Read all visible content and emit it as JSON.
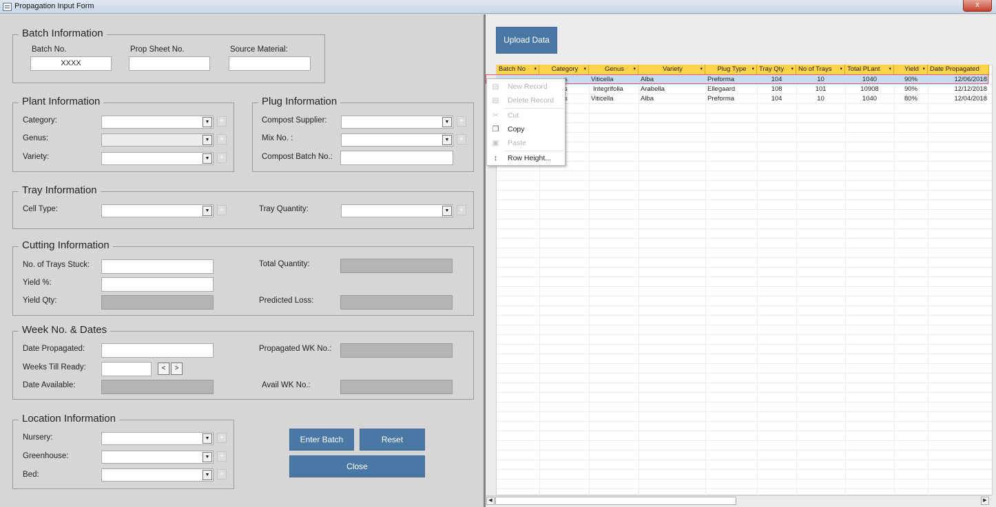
{
  "window": {
    "title": "Propagation Input Form",
    "close_label": "x"
  },
  "batch": {
    "title": "Batch Information",
    "batch_no_label": "Batch No.",
    "batch_no_value": "XXXX",
    "prop_sheet_label": "Prop Sheet No.",
    "source_label": "Source Material:"
  },
  "plant": {
    "title": "Plant Information",
    "category_label": "Category:",
    "genus_label": "Genus:",
    "variety_label": "Variety:"
  },
  "plug": {
    "title": "Plug Information",
    "compost_supplier_label": "Compost Supplier:",
    "mix_label": "Mix No. :",
    "compost_batch_label": "Compost Batch No.:"
  },
  "tray": {
    "title": "Tray Information",
    "cell_type_label": "Cell Type:",
    "tray_qty_label": "Tray Quantity:"
  },
  "cutting": {
    "title": "Cutting Information",
    "trays_stuck_label": "No. of Trays Stuck:",
    "yield_pct_label": "Yield %:",
    "yield_qty_label": "Yield Qty:",
    "total_qty_label": "Total Quantity:",
    "predicted_loss_label": "Predicted Loss:"
  },
  "week": {
    "title": "Week No. & Dates",
    "date_prop_label": "Date Propagated:",
    "weeks_ready_label": "Weeks Till Ready:",
    "date_avail_label": "Date Available:",
    "prop_wk_label": "Propagated WK No.:",
    "avail_wk_label": "Avail WK No.:",
    "prev_label": "<",
    "next_label": ">"
  },
  "location": {
    "title": "Location Information",
    "nursery_label": "Nursery:",
    "greenhouse_label": "Greenhouse:",
    "bed_label": "Bed:"
  },
  "buttons": {
    "enter_batch": "Enter Batch",
    "reset": "Reset",
    "close": "Close",
    "upload": "Upload Data"
  },
  "icons": {
    "dropdown": "▼",
    "plus": "+",
    "sort": "▾"
  },
  "table": {
    "columns": [
      "Batch No",
      "Category",
      "Genus",
      "Variety",
      "Plug Type",
      "Tray Qty",
      "No of Trays",
      "Total PLant",
      "Yield",
      "Date Propagated"
    ],
    "rows": [
      [
        "",
        "s",
        "Viticella",
        "Alba",
        "Preforma",
        "104",
        "10",
        "1040",
        "90%",
        "12/06/2018"
      ],
      [
        "",
        "s",
        "Integrifolia",
        "Arabella",
        "Ellegaard",
        "108",
        "101",
        "10908",
        "90%",
        "12/12/2018"
      ],
      [
        "",
        "s",
        "Viticella",
        "Alba",
        "Preforma",
        "104",
        "10",
        "1040",
        "80%",
        "12/04/2018"
      ]
    ]
  },
  "context_menu": {
    "items": [
      {
        "label": "New Record",
        "icon": "new-record-icon",
        "enabled": false
      },
      {
        "label": "Delete Record",
        "icon": "delete-record-icon",
        "enabled": false
      },
      {
        "label": "Cut",
        "icon": "scissors-icon",
        "enabled": false
      },
      {
        "label": "Copy",
        "icon": "copy-icon",
        "enabled": true
      },
      {
        "label": "Paste",
        "icon": "paste-icon",
        "enabled": false
      },
      {
        "label": "Row Height...",
        "icon": "row-height-icon",
        "enabled": true
      }
    ]
  },
  "colors": {
    "button": "#4a78a4",
    "header": "#ffd24a",
    "selected_row": "#c7dcf1",
    "close_button": "#c5422c"
  }
}
